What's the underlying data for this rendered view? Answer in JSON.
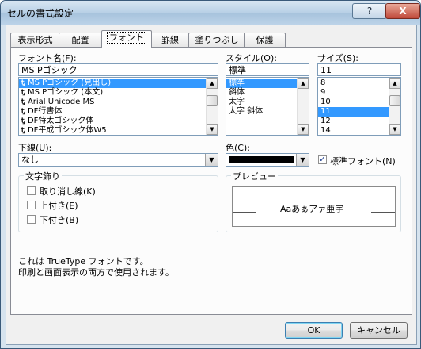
{
  "window": {
    "title": "セルの書式設定",
    "help_label": "?",
    "close_label": "X"
  },
  "tabs": [
    {
      "label": "表示形式"
    },
    {
      "label": "配置"
    },
    {
      "label": "フォント"
    },
    {
      "label": "罫線"
    },
    {
      "label": "塗りつぶし"
    },
    {
      "label": "保護"
    }
  ],
  "font": {
    "label": "フォント名(F):",
    "value": "MS Pゴシック",
    "items": [
      {
        "label": "MS Pゴシック (見出し)"
      },
      {
        "label": "MS Pゴシック (本文)"
      },
      {
        "label": "Arial Unicode MS"
      },
      {
        "label": "DF行書体"
      },
      {
        "label": "DF特太ゴシック体"
      },
      {
        "label": "DF平成ゴシック体W5"
      }
    ],
    "selected": 0,
    "icon_glyph": "Ꮏ"
  },
  "style": {
    "label": "スタイル(O):",
    "value": "標準",
    "items": [
      {
        "label": "標準"
      },
      {
        "label": "斜体"
      },
      {
        "label": "太字"
      },
      {
        "label": "太字 斜体"
      }
    ],
    "selected": 0
  },
  "size": {
    "label": "サイズ(S):",
    "value": "11",
    "items": [
      {
        "label": "8"
      },
      {
        "label": "9"
      },
      {
        "label": "10"
      },
      {
        "label": "11"
      },
      {
        "label": "12"
      },
      {
        "label": "14"
      }
    ],
    "selected": 3
  },
  "underline": {
    "label": "下線(U):",
    "value": "なし"
  },
  "color": {
    "label": "色(C):",
    "swatch": "#000000",
    "default_font_label": "標準フォント(N)",
    "default_font_checked": true
  },
  "effects": {
    "title": "文字飾り",
    "items": [
      {
        "label": "取り消し線(K)",
        "checked": false
      },
      {
        "label": "上付き(E)",
        "checked": false
      },
      {
        "label": "下付き(B)",
        "checked": false
      }
    ]
  },
  "preview": {
    "title": "プレビュー",
    "sample": "Aaあぁアァ亜宇"
  },
  "info": {
    "line1": "これは TrueType フォントです。",
    "line2": "印刷と画面表示の両方で使用されます。"
  },
  "buttons": {
    "ok": "OK",
    "cancel": "キャンセル"
  },
  "colors": {
    "selection": "#3399ff",
    "title_gradient_top": "#d8e6f2",
    "close_button": "#c0493a"
  }
}
